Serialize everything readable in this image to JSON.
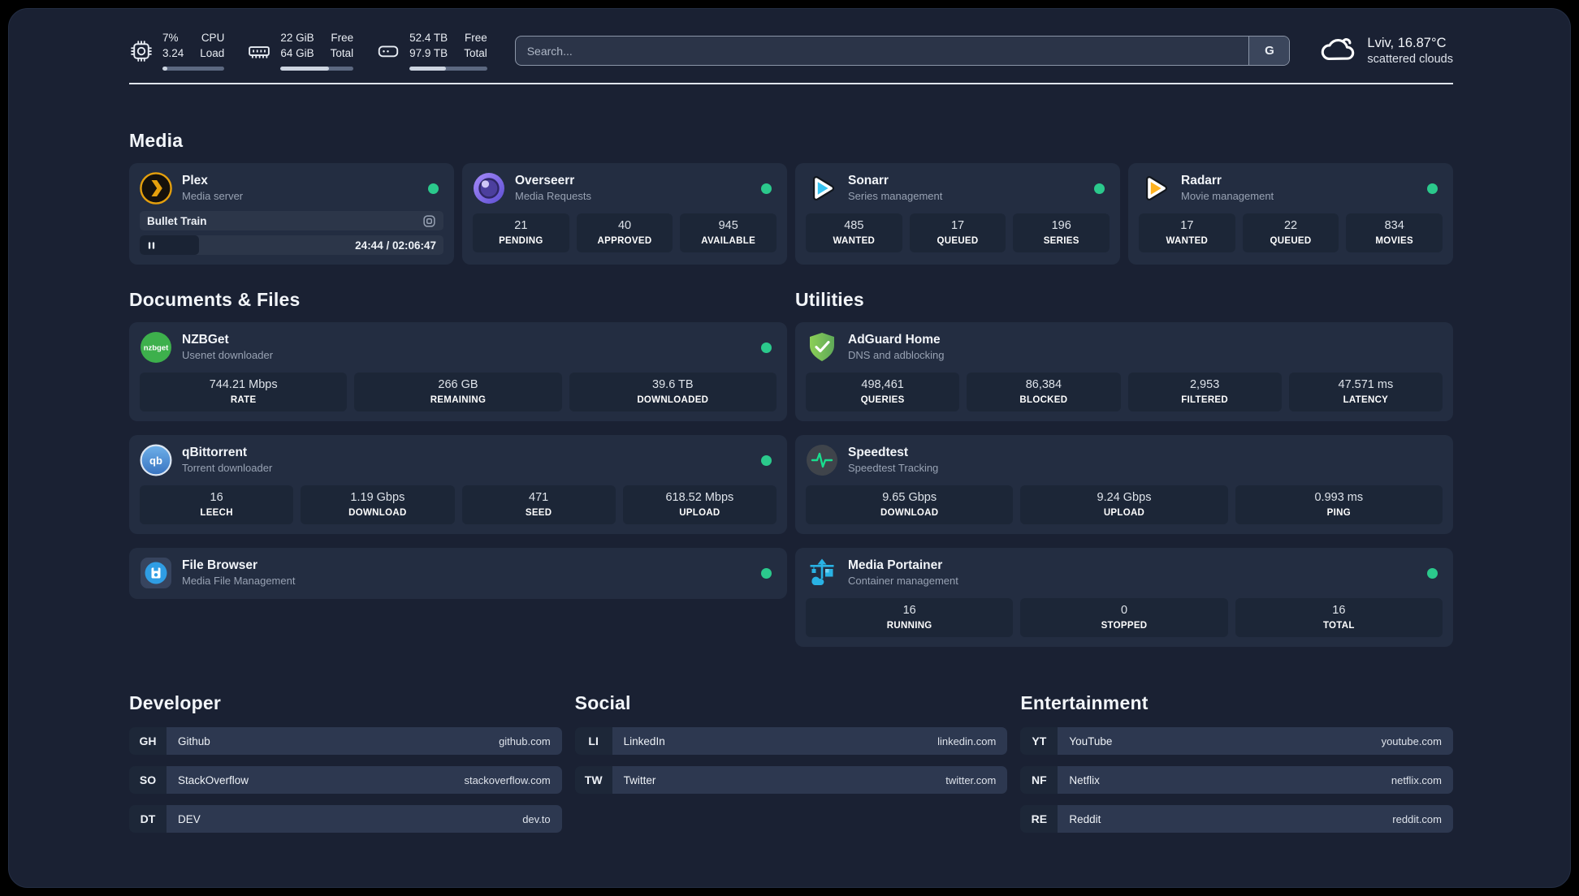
{
  "topbar": {
    "system_stats": [
      {
        "icon": "cpu-icon",
        "rows": [
          {
            "value": "7%",
            "label": "CPU"
          },
          {
            "value": "3.24",
            "label": "Load"
          }
        ],
        "progress_pct": 8
      },
      {
        "icon": "ram-icon",
        "rows": [
          {
            "value": "22 GiB",
            "label": "Free"
          },
          {
            "value": "64 GiB",
            "label": "Total"
          }
        ],
        "progress_pct": 66
      },
      {
        "icon": "disk-icon",
        "rows": [
          {
            "value": "52.4 TB",
            "label": "Free"
          },
          {
            "value": "97.9 TB",
            "label": "Total"
          }
        ],
        "progress_pct": 47
      }
    ],
    "search": {
      "placeholder": "Search...",
      "engine_button": "G"
    },
    "weather": {
      "icon": "cloud-icon",
      "location_temp": "Lviv, 16.87°C",
      "condition": "scattered clouds"
    }
  },
  "app_sections": [
    {
      "title": "Media",
      "apps": [
        {
          "name": "Plex",
          "subtitle": "Media server",
          "icon": "plex-icon",
          "online": true,
          "media_player": {
            "track": "Bullet Train",
            "state": "paused",
            "time_display": "24:44 / 02:06:47",
            "elapsed": "24:44",
            "duration": "02:06:47",
            "progress_pct": 19.5
          }
        },
        {
          "name": "Overseerr",
          "subtitle": "Media Requests",
          "icon": "overseerr-icon",
          "online": true,
          "stats": [
            {
              "value": "21",
              "label": "PENDING"
            },
            {
              "value": "40",
              "label": "APPROVED"
            },
            {
              "value": "945",
              "label": "AVAILABLE"
            }
          ]
        },
        {
          "name": "Sonarr",
          "subtitle": "Series management",
          "icon": "sonarr-icon",
          "online": true,
          "stats": [
            {
              "value": "485",
              "label": "WANTED"
            },
            {
              "value": "17",
              "label": "QUEUED"
            },
            {
              "value": "196",
              "label": "SERIES"
            }
          ]
        },
        {
          "name": "Radarr",
          "subtitle": "Movie management",
          "icon": "radarr-icon",
          "online": true,
          "stats": [
            {
              "value": "17",
              "label": "WANTED"
            },
            {
              "value": "22",
              "label": "QUEUED"
            },
            {
              "value": "834",
              "label": "MOVIES"
            }
          ]
        }
      ]
    },
    {
      "title": "Documents & Files",
      "apps": [
        {
          "name": "NZBGet",
          "subtitle": "Usenet downloader",
          "icon": "nzbget-icon",
          "online": true,
          "stats": [
            {
              "value": "744.21 Mbps",
              "label": "RATE"
            },
            {
              "value": "266 GB",
              "label": "REMAINING"
            },
            {
              "value": "39.6 TB",
              "label": "DOWNLOADED"
            }
          ]
        },
        {
          "name": "qBittorrent",
          "subtitle": "Torrent downloader",
          "icon": "qbittorrent-icon",
          "online": true,
          "stats": [
            {
              "value": "16",
              "label": "LEECH"
            },
            {
              "value": "1.19 Gbps",
              "label": "DOWNLOAD"
            },
            {
              "value": "471",
              "label": "SEED"
            },
            {
              "value": "618.52 Mbps",
              "label": "UPLOAD"
            }
          ]
        },
        {
          "name": "File Browser",
          "subtitle": "Media File Management",
          "icon": "filebrowser-icon",
          "online": true
        }
      ]
    },
    {
      "title": "Utilities",
      "apps": [
        {
          "name": "AdGuard Home",
          "subtitle": "DNS and adblocking",
          "icon": "adguard-icon",
          "online": false,
          "stats": [
            {
              "value": "498,461",
              "label": "QUERIES"
            },
            {
              "value": "86,384",
              "label": "BLOCKED"
            },
            {
              "value": "2,953",
              "label": "FILTERED"
            },
            {
              "value": "47.571 ms",
              "label": "LATENCY"
            }
          ]
        },
        {
          "name": "Speedtest",
          "subtitle": "Speedtest Tracking",
          "icon": "speedtest-icon",
          "online": false,
          "stats": [
            {
              "value": "9.65 Gbps",
              "label": "DOWNLOAD"
            },
            {
              "value": "9.24 Gbps",
              "label": "UPLOAD"
            },
            {
              "value": "0.993 ms",
              "label": "PING"
            }
          ]
        },
        {
          "name": "Media Portainer",
          "subtitle": "Container management",
          "icon": "portainer-icon",
          "online": true,
          "stats": [
            {
              "value": "16",
              "label": "RUNNING"
            },
            {
              "value": "0",
              "label": "STOPPED"
            },
            {
              "value": "16",
              "label": "TOTAL"
            }
          ]
        }
      ]
    }
  ],
  "link_sections": [
    {
      "title": "Developer",
      "links": [
        {
          "abbr": "GH",
          "name": "Github",
          "url": "github.com"
        },
        {
          "abbr": "SO",
          "name": "StackOverflow",
          "url": "stackoverflow.com"
        },
        {
          "abbr": "DT",
          "name": "DEV",
          "url": "dev.to"
        }
      ]
    },
    {
      "title": "Social",
      "links": [
        {
          "abbr": "LI",
          "name": "LinkedIn",
          "url": "linkedin.com"
        },
        {
          "abbr": "TW",
          "name": "Twitter",
          "url": "twitter.com"
        }
      ]
    },
    {
      "title": "Entertainment",
      "links": [
        {
          "abbr": "YT",
          "name": "YouTube",
          "url": "youtube.com"
        },
        {
          "abbr": "NF",
          "name": "Netflix",
          "url": "netflix.com"
        },
        {
          "abbr": "RE",
          "name": "Reddit",
          "url": "reddit.com"
        }
      ]
    }
  ],
  "colors": {
    "status_online": "#2bc98c",
    "plex_accent": "#e5a00d",
    "divider": "#dfe5ed"
  }
}
